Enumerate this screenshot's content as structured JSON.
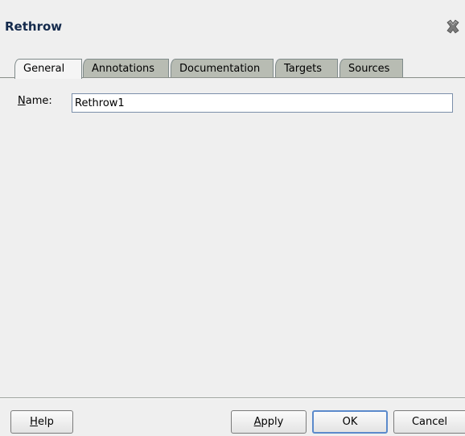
{
  "dialog": {
    "title": "Rethrow",
    "close_icon": "close-x-icon"
  },
  "tabs": [
    {
      "label": "General",
      "active": true
    },
    {
      "label": "Annotations",
      "active": false
    },
    {
      "label": "Documentation",
      "active": false
    },
    {
      "label": "Targets",
      "active": false
    },
    {
      "label": "Sources",
      "active": false
    }
  ],
  "general": {
    "name_label_mnemonic": "N",
    "name_label_rest": "ame:",
    "name_value": "Rethrow1"
  },
  "buttons": {
    "help_mnemonic": "H",
    "help_rest": "elp",
    "apply_mnemonic": "A",
    "apply_rest": "pply",
    "ok": "OK",
    "cancel": "Cancel"
  },
  "colors": {
    "title": "#142a4c",
    "background": "#efefef",
    "inactive_tab": "#b8bcb3",
    "default_button_border": "#5b8acb"
  }
}
